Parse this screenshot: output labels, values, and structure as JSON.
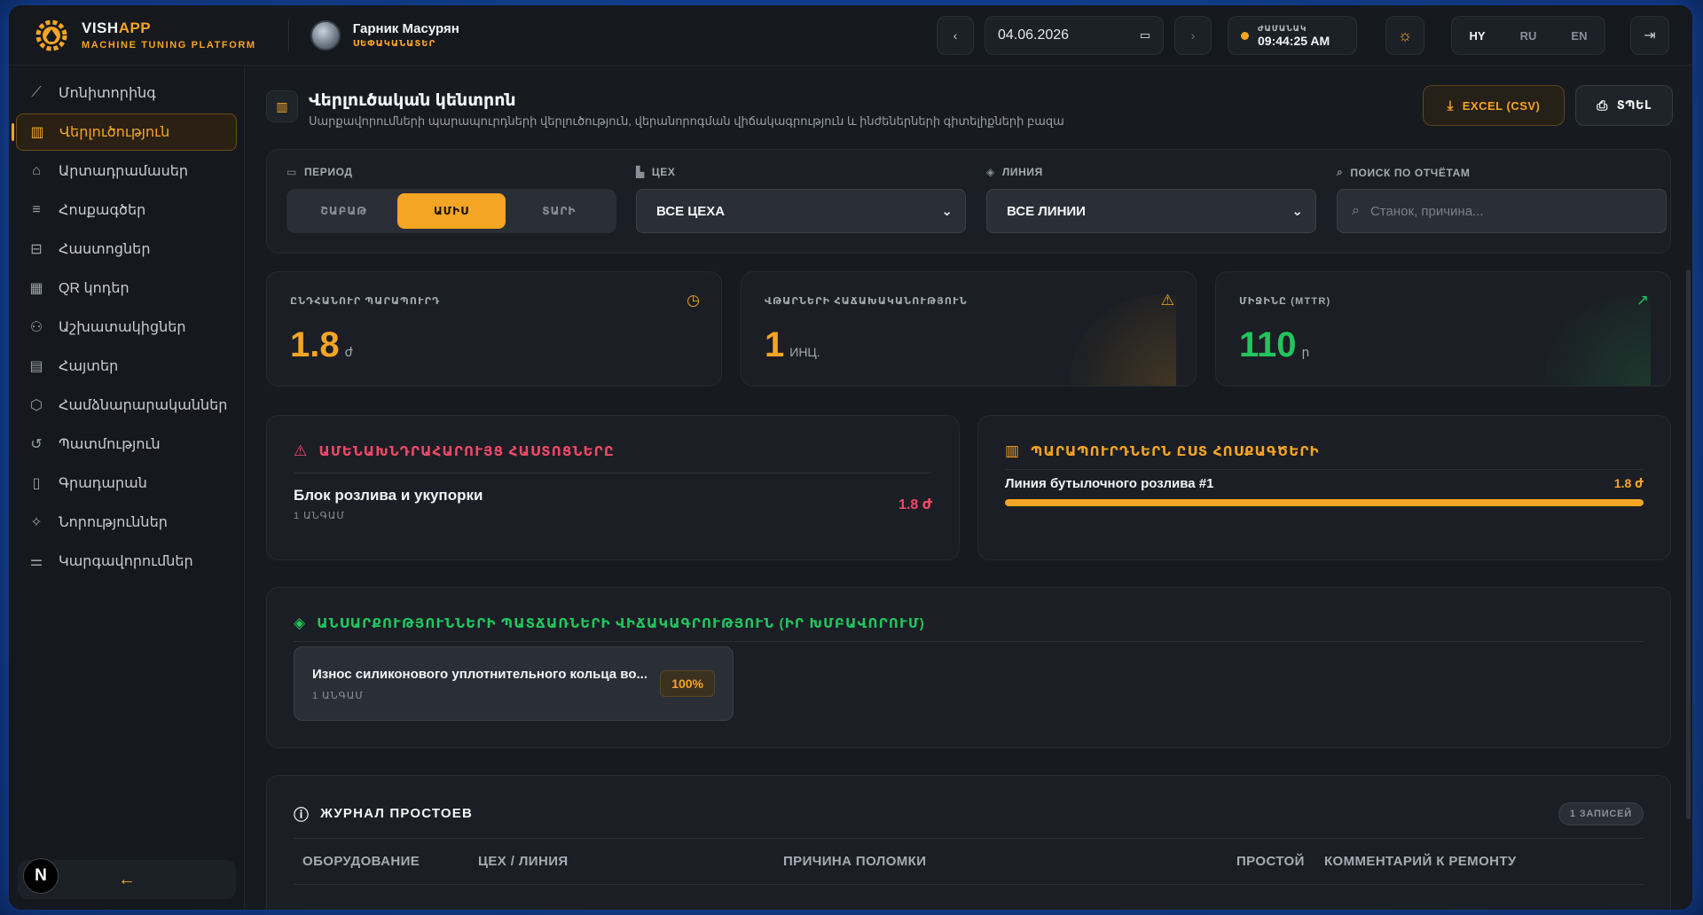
{
  "header": {
    "brand_main": "VISH",
    "brand_accent": "APP",
    "brand_sub": "MACHINE TUNING PLATFORM",
    "user_name": "Гарник Масурян",
    "user_role": "ՍԵՓԱԿԱՆԱՏԵՐ",
    "date_value": "04.06.2026",
    "clock_label": "ԺԱՄԱՆԱԿ",
    "clock_time": "09:44:25 AM",
    "languages": [
      "HY",
      "RU",
      "EN"
    ],
    "active_language": "HY"
  },
  "sidebar": {
    "items": [
      {
        "label": "Մոնիտորինգ",
        "icon": "chart-line-icon"
      },
      {
        "label": "Վերլուծություն",
        "icon": "bar-chart-icon",
        "active": true
      },
      {
        "label": "Արտադրամասեր",
        "icon": "building-icon"
      },
      {
        "label": "Հոսքագծեր",
        "icon": "list-icon"
      },
      {
        "label": "Հաստոցներ",
        "icon": "machine-icon"
      },
      {
        "label": "QR կոդեր",
        "icon": "qr-icon"
      },
      {
        "label": "Աշխատակիցներ",
        "icon": "users-icon"
      },
      {
        "label": "Հայտեր",
        "icon": "file-icon"
      },
      {
        "label": "Համձնարարականներ",
        "icon": "cube-icon"
      },
      {
        "label": "Պատմություն",
        "icon": "history-icon"
      },
      {
        "label": "Գրադարան",
        "icon": "book-icon"
      },
      {
        "label": "Նորություններ",
        "icon": "sparkle-icon"
      },
      {
        "label": "Կարգավորումներ",
        "icon": "sliders-icon"
      }
    ],
    "collapse_icon": "←",
    "badge": "N"
  },
  "page": {
    "title": "Վերլուծական կենտրոն",
    "subtitle": "Սարքավորումների պարապուրդների վերլուծություն, վերանորոգման վիճակագրություն և ինժեներների գիտելիքների բազա",
    "excel_button": "EXCEL (CSV)",
    "print_button": "ՏՊԵԼ"
  },
  "filters": {
    "period_label": "ПЕРИОД",
    "period_options": [
      "ՇԱԲԱԹ",
      "ԱՄԻՍ",
      "ՏԱՐԻ"
    ],
    "period_active": "ԱՄԻՍ",
    "shop_label": "ЦЕХ",
    "shop_value": "ВСЕ ЦЕХА",
    "line_label": "ЛИНИЯ",
    "line_value": "ВСЕ ЛИНИИ",
    "search_label": "ПОИСК ПО ОТЧЁТАМ",
    "search_placeholder": "Станок, причина..."
  },
  "kpis": [
    {
      "label": "ԸՆԴՀԱՆՈՒՐ ՊԱՐԱՊՈՒՐԴ",
      "value": "1.8",
      "unit": "ժ",
      "icon": "clock-icon",
      "color": "#f5a524"
    },
    {
      "label": "ՎԹԱՐՆԵՐԻ ՀԱՃԱԽԱԿԱՆՈՒԹՅՈՒՆ",
      "value": "1",
      "unit": "ИНЦ.",
      "icon": "warning-icon",
      "color": "#f5a524"
    },
    {
      "label": "ՄԻՋԻՆԸ (MTTR)",
      "value": "110",
      "unit": "ր",
      "icon": "trend-up-icon",
      "color": "#22c55e"
    }
  ],
  "problem_equipment": {
    "title": "ԱՄԵՆԱԽՆԴՐԱՀԱՐՈՒՅՑ ՀԱՍՏՈՑՆԵՐԸ",
    "name": "Блок розлива и укупорки",
    "sub": "1 ԱՆԳԱՄ",
    "value": "1.8 ժ"
  },
  "downtime_by_line": {
    "title": "ՊԱՐԱՊՈՒՐԴՆԵՐՆ ԸՍՏ ՀՈՍՔԱԳԾԵՐԻ",
    "line_name": "Линия бутылочного розлива #1",
    "line_value": "1.8 ժ",
    "fill_fraction": 1.0
  },
  "fault_causes": {
    "title": "ԱՆՍԱՐՔՈՒԹՅՈՒՆՆԵՐԻ ՊԱՏՃԱՌՆԵՐԻ ՎԻՃԱԿԱԳՐՈՒԹՅՈՒՆ (ԻՐ ԽՄԲԱՎՈՐՈՒՄ)",
    "cause_name": "Износ силиконового уплотнительного кольца во...",
    "cause_sub": "1 ԱՆԳԱՄ",
    "cause_pct": "100%"
  },
  "downtime_log": {
    "title": "ЖУРНАЛ ПРОСТОЕВ",
    "count": "1 ЗАПИСЕЙ",
    "columns": [
      "ОБОРУДОВАНИЕ",
      "ЦЕХ / ЛИНИЯ",
      "ПРИЧИНА ПОЛОМКИ",
      "ПРОСТОЙ",
      "КОММЕНТАРИЙ К РЕМОНТУ"
    ]
  }
}
